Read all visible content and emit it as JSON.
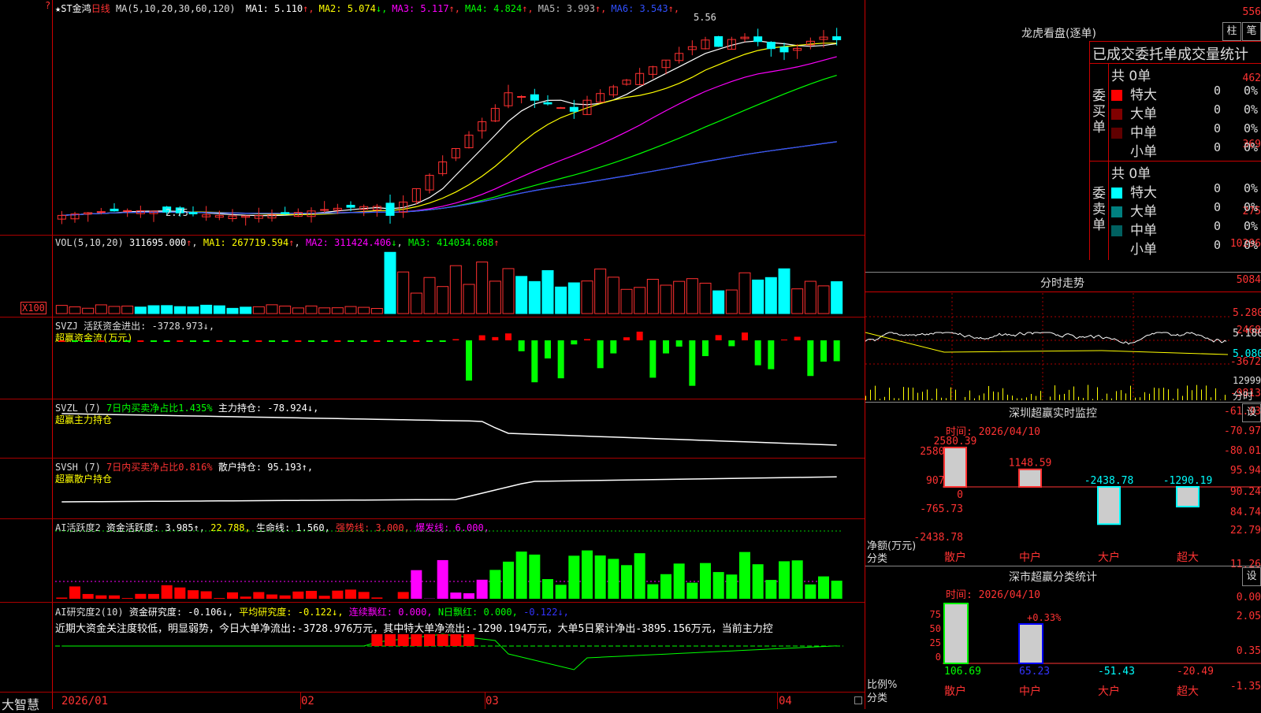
{
  "main": {
    "title_prefix": "★ST金鸿",
    "title_period": "日线",
    "ma_header": "MA(5,10,20,30,60,120)",
    "ma": [
      {
        "label": "MA1:",
        "value": "5.110",
        "arrow": "↑",
        "color": "#ffffff"
      },
      {
        "label": "MA2:",
        "value": "5.074",
        "arrow": "↓",
        "color": "#ffff00"
      },
      {
        "label": "MA3:",
        "value": "5.117",
        "arrow": "↑",
        "color": "#ff00ff"
      },
      {
        "label": "MA4:",
        "value": "4.824",
        "arrow": "↑",
        "color": "#00ff00"
      },
      {
        "label": "MA5:",
        "value": "3.993",
        "arrow": "↑",
        "color": "#bbbbbb"
      },
      {
        "label": "MA6:",
        "value": "3.543",
        "arrow": "↑",
        "color": "#3050ff"
      }
    ],
    "y_labels": [
      "556",
      "462",
      "369",
      "275"
    ],
    "high_marker": "5.56",
    "low_marker": "2.75",
    "corner_mark": "?"
  },
  "vol": {
    "header_name": "VOL(5,10,20)",
    "header_value": "311695.000",
    "ma1": "MA1: 267719.594",
    "ma2": "MA2: 311424.406",
    "ma3": "MA3: 414034.688",
    "y_labels": [
      "10296",
      "5084"
    ],
    "unit": "X100"
  },
  "svzj": {
    "line1": "SVZJ  活跃资金进出: -3728.973↓,",
    "line2": "超赢资金流(万元)",
    "y_labels": [
      "2468",
      "-3672",
      "-9813"
    ]
  },
  "svzl": {
    "name": "SVZL (7)",
    "ratio": "7日内买卖净占比1.435%",
    "hold": "主力持仓: -78.924↓,",
    "line2": "超赢主力持仓",
    "y_labels": [
      "-61.93",
      "-70.97",
      "-80.01"
    ]
  },
  "svsh": {
    "name": "SVSH (7)",
    "ratio": "7日内买卖净占比0.816%",
    "hold": "散户持仓: 95.193↑,",
    "line2": "超赢散户持仓",
    "y_labels": [
      "95.94",
      "90.24",
      "84.74"
    ]
  },
  "ai_active": {
    "name": "AI活跃度2",
    "a": "资金活跃度: 3.985↑,",
    "b": "22.788,",
    "c": "生命线: 1.560,",
    "d": "强势线: 3.000,",
    "e": "爆发线: 6.000,",
    "y_labels": [
      "22.79",
      "11.26",
      "0.00"
    ]
  },
  "ai_research": {
    "name": "AI研究度2(10)",
    "a": "资金研究度: -0.106↓,",
    "b": "平均研究度: -0.122↓,",
    "c": "连续飘红: 0.000,",
    "d": "N日飘红: 0.000,",
    "e": "-0.122↓,",
    "summary": "近期大资金关注度较低，明显弱势，今日大单净流出:-3728.976万元，其中特大单净流出:-1290.194万元，大单5日累计净出-3895.156万元，当前主力控",
    "y_labels": [
      "2.05",
      "0.35",
      "-1.35"
    ]
  },
  "xaxis": {
    "brand": "大智慧",
    "labels": [
      "2026/01",
      "02",
      "03",
      "04"
    ]
  },
  "right": {
    "lhb_title": "龙虎看盘(逐单)",
    "btn_zhu": "柱",
    "btn_bi": "笔",
    "stats_title": "已成交委托单成交量统计",
    "buy": {
      "side_label": "委买单",
      "total": "共 0单",
      "rows": [
        {
          "name": "特大",
          "count": "0",
          "pct": "0%",
          "color": "#ff0000"
        },
        {
          "name": "大单",
          "count": "0",
          "pct": "0%",
          "color": "#800000"
        },
        {
          "name": "中单",
          "count": "0",
          "pct": "0%",
          "color": "#600000"
        },
        {
          "name": "小单",
          "count": "0",
          "pct": "0%",
          "color": "#000000"
        }
      ]
    },
    "sell": {
      "side_label": "委卖单",
      "total": "共 0单",
      "rows": [
        {
          "name": "特大",
          "count": "0",
          "pct": "0%",
          "color": "#00ffff"
        },
        {
          "name": "大单",
          "count": "0",
          "pct": "0%",
          "color": "#008080"
        },
        {
          "name": "中单",
          "count": "0",
          "pct": "0%",
          "color": "#006060"
        },
        {
          "name": "小单",
          "count": "0",
          "pct": "0%",
          "color": "#000000"
        }
      ]
    },
    "intraday_title": "分时走势",
    "intraday_y": [
      "5.280",
      "5.180",
      "5.080",
      "12999"
    ],
    "intraday_unit": "分时",
    "sz_monitor": {
      "title": "深圳超赢实时监控",
      "settings": "设",
      "time": "时间: 2026/04/10",
      "y_labels": [
        "2580.39",
        "907.33",
        "0",
        "-765.73",
        "-2438.78"
      ],
      "bars": [
        {
          "cat": "散户",
          "value": "2580.39",
          "num": 2580.39
        },
        {
          "cat": "中户",
          "value": "1148.59",
          "num": 1148.59
        },
        {
          "cat": "大户",
          "value": "-2438.78",
          "num": -2438.78
        },
        {
          "cat": "超大",
          "value": "-1290.19",
          "num": -1290.19
        }
      ],
      "axis_title1": "净额(万元)",
      "axis_title2": "分类"
    },
    "sz_class": {
      "title": "深市超赢分类统计",
      "settings": "设",
      "time": "时间: 2026/04/10",
      "y_labels": [
        "75",
        "50",
        "25",
        "0"
      ],
      "pct_label": "+0.33%",
      "bars": [
        {
          "cat": "散户",
          "value": "106.69"
        },
        {
          "cat": "中户",
          "value": "65.23"
        },
        {
          "cat": "大户",
          "value": "-51.43"
        },
        {
          "cat": "超大",
          "value": "-20.49"
        }
      ],
      "axis_title1": "比例%",
      "axis_title2": "分类"
    }
  },
  "colors": {
    "up": "#ff3030",
    "down": "#00ffff",
    "grid": "#aa0000",
    "green": "#00ff00",
    "yellow": "#ffff00",
    "magenta": "#ff00ff"
  }
}
